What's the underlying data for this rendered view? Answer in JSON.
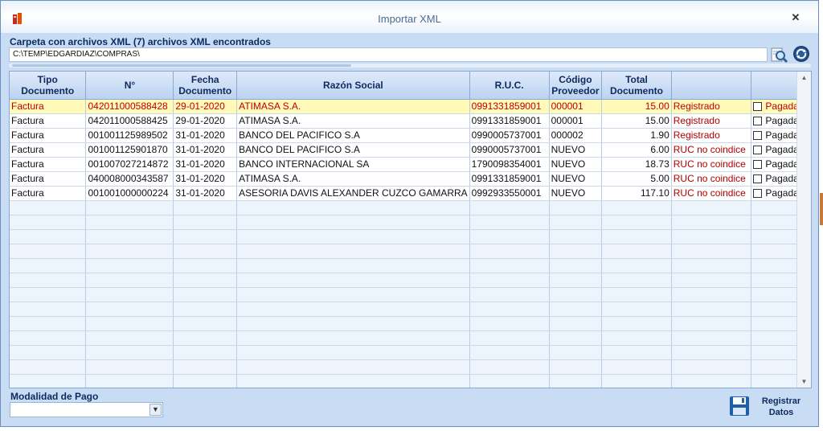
{
  "window": {
    "title": "Importar XML",
    "close_symbol": "✕"
  },
  "folder": {
    "label": "Carpeta con archivos XML (7) archivos XML encontrados",
    "path": "C:\\TEMP\\EDGARDIAZ\\COMPRAS\\"
  },
  "grid": {
    "columns": [
      "Tipo Documento",
      "N°",
      "Fecha Documento",
      "Razón Social",
      "R.U.C.",
      "Código Proveedor",
      "Total Documento",
      "",
      ""
    ],
    "rows": [
      [
        "Factura",
        "042011000588428",
        "29-01-2020",
        "ATIMASA S.A.",
        "0991331859001",
        "000001",
        "15.00",
        "Registrado",
        "Pagada"
      ],
      [
        "Factura",
        "042011000588425",
        "29-01-2020",
        "ATIMASA S.A.",
        "0991331859001",
        "000001",
        "15.00",
        "Registrado",
        "Pagada"
      ],
      [
        "Factura",
        "001001125989502",
        "31-01-2020",
        "BANCO DEL PACIFICO S.A",
        "0990005737001",
        "000002",
        "1.90",
        "Registrado",
        "Pagada"
      ],
      [
        "Factura",
        "001001125901870",
        "31-01-2020",
        "BANCO DEL PACIFICO S.A",
        "0990005737001",
        "NUEVO",
        "6.00",
        "RUC no coindice",
        "Pagada"
      ],
      [
        "Factura",
        "001007027214872",
        "31-01-2020",
        "BANCO INTERNACIONAL SA",
        "1790098354001",
        "NUEVO",
        "18.73",
        "RUC no coindice",
        "Pagada"
      ],
      [
        "Factura",
        "040008000343587",
        "31-01-2020",
        "ATIMASA S.A.",
        "0991331859001",
        "NUEVO",
        "5.00",
        "RUC no coindice",
        "Pagada"
      ],
      [
        "Factura",
        "001001000000224",
        "31-01-2020",
        "ASESORIA DAVIS ALEXANDER CUZCO GAMARRA",
        "0992933550001",
        "NUEVO",
        "117.10",
        "RUC no coindice",
        "Pagada"
      ]
    ],
    "selected_row": 0
  },
  "modalidad": {
    "label": "Modalidad de Pago",
    "value": ""
  },
  "register": {
    "label_line1": "Registrar",
    "label_line2": "Datos"
  },
  "colors": {
    "accent": "#0d2a5e",
    "selected_row_bg": "#fffab8",
    "selected_row_text": "#c00000",
    "window_bg": "#c8dcf4"
  },
  "icons": [
    "app-icon",
    "close-icon",
    "search-folder-icon",
    "refresh-icon",
    "save-disk-icon",
    "chevron-down-icon"
  ]
}
